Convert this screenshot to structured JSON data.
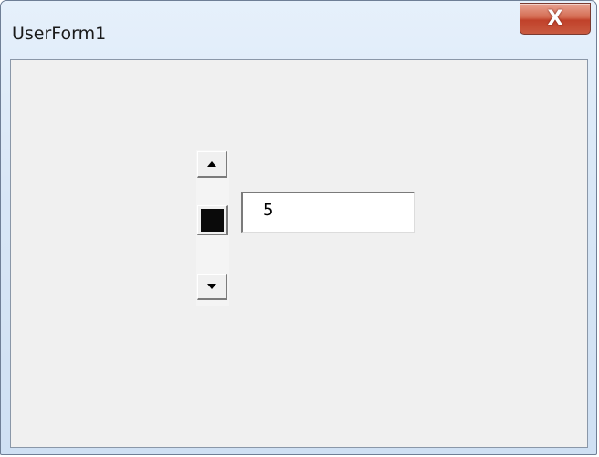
{
  "window": {
    "title": "UserForm1",
    "close_label": "X"
  },
  "form": {
    "spin_button": {
      "up_icon": "arrow-up-icon",
      "down_icon": "arrow-down-icon"
    },
    "textbox": {
      "value": "5"
    }
  }
}
